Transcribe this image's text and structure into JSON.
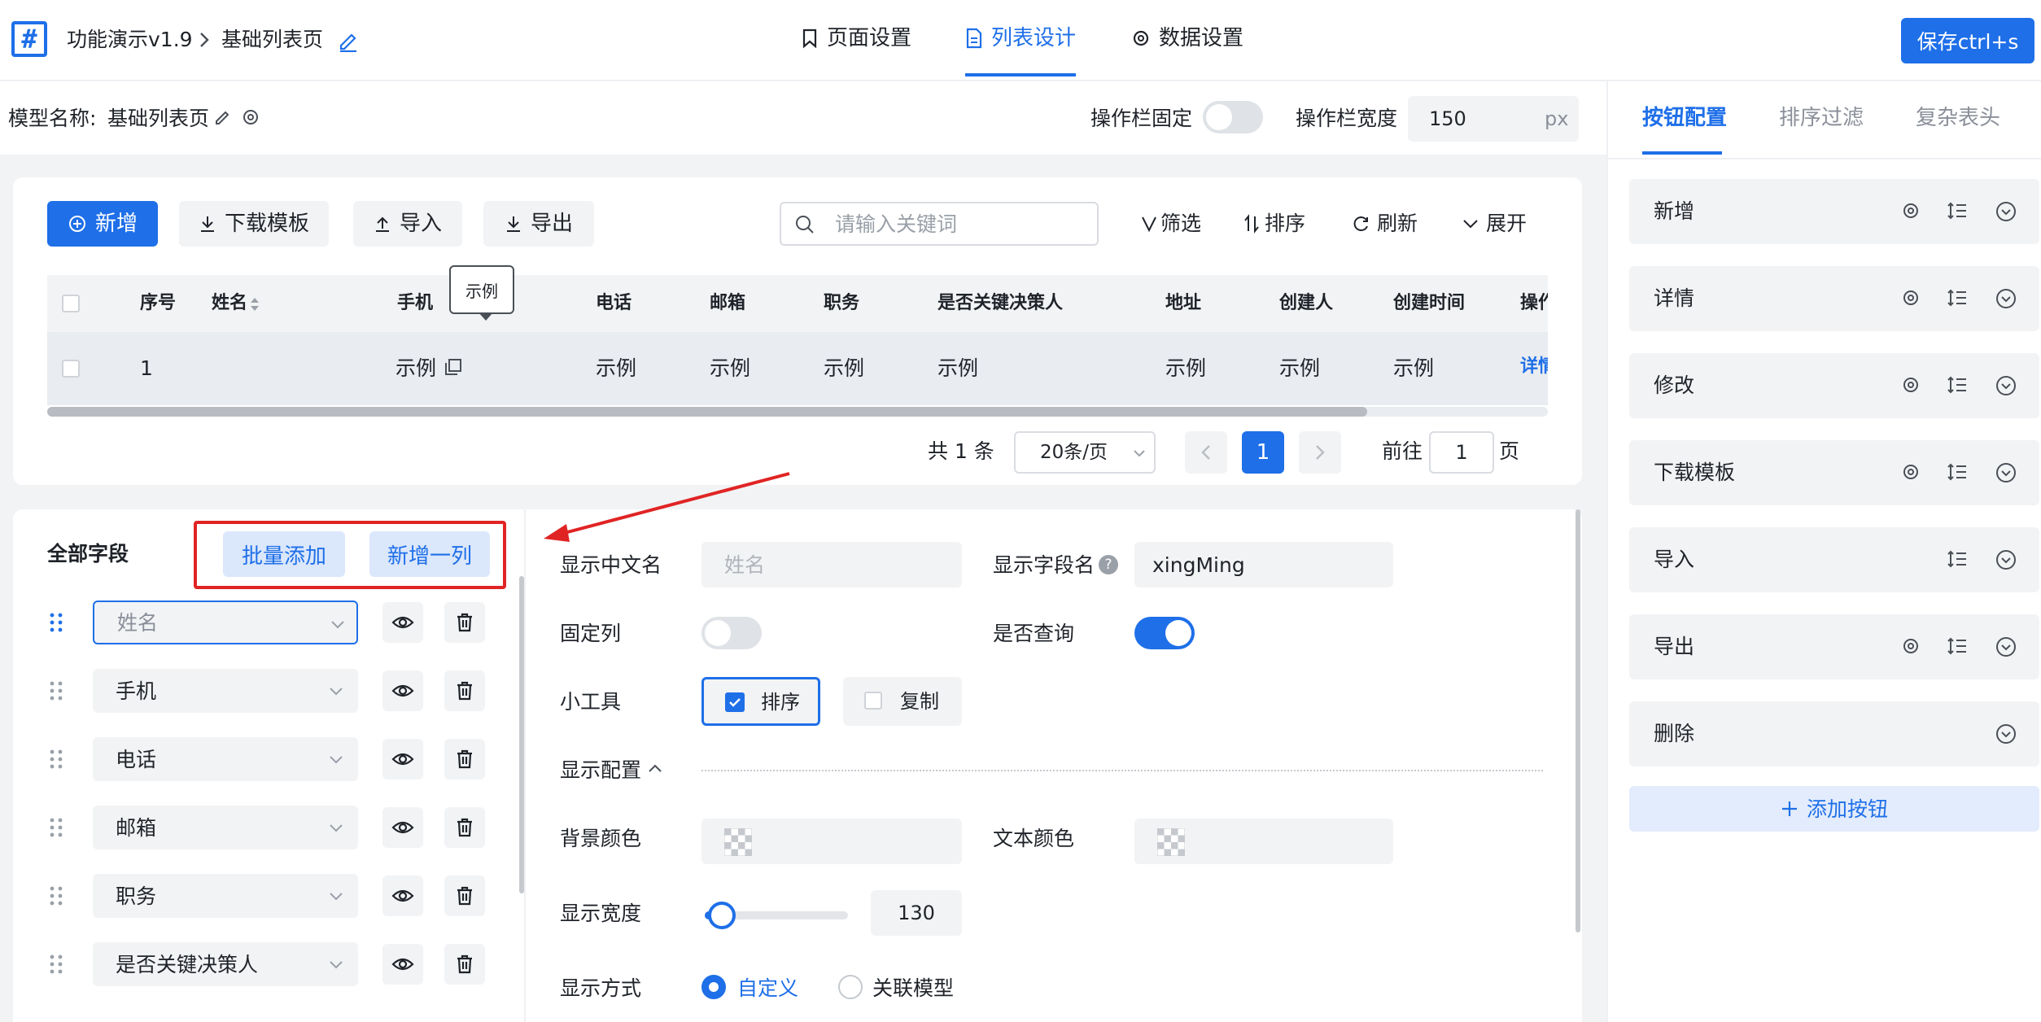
{
  "header": {
    "app_title": "功能演示v1.9",
    "page_name": "基础列表页",
    "tabs": [
      {
        "label": "页面设置",
        "icon": "bookmark-icon"
      },
      {
        "label": "列表设计",
        "icon": "document-icon"
      },
      {
        "label": "数据设置",
        "icon": "gear-icon"
      }
    ],
    "active_tab": "列表设计",
    "save_label": "保存ctrl+s"
  },
  "model_bar": {
    "model_label": "模型名称:",
    "model_name": "基础列表页",
    "fixed_label": "操作栏固定",
    "fixed_on": false,
    "width_label": "操作栏宽度",
    "width_value": "150",
    "width_unit": "px"
  },
  "toolbar": {
    "add_label": "新增",
    "download_label": "下载模板",
    "import_label": "导入",
    "export_label": "导出",
    "search_placeholder": "请输入关键词",
    "filter_label": "筛选",
    "sort_label": "排序",
    "refresh_label": "刷新",
    "expand_label": "展开"
  },
  "table": {
    "columns": [
      "序号",
      "姓名",
      "手机",
      "电话",
      "邮箱",
      "职务",
      "是否关键决策人",
      "地址",
      "创建人",
      "创建时间",
      "操作"
    ],
    "row": {
      "index": "1",
      "phone": "示例",
      "tel": "示例",
      "email": "示例",
      "job": "示例",
      "key_decision": "示例",
      "address": "示例",
      "creator": "示例",
      "created": "示例",
      "action": "详情"
    },
    "tooltip": "示例"
  },
  "pager": {
    "total": "共 1 条",
    "page_size": "20条/页",
    "current_page": "1",
    "goto_label": "前往",
    "goto_value": "1",
    "page_unit": "页"
  },
  "fields_panel": {
    "title": "全部字段",
    "batch_add": "批量添加",
    "add_column": "新增一列",
    "fields": [
      "姓名",
      "手机",
      "电话",
      "邮箱",
      "职务",
      "是否关键决策人"
    ]
  },
  "field_form": {
    "cn_name_label": "显示中文名",
    "cn_name_placeholder": "姓名",
    "field_name_label": "显示字段名",
    "field_name_value": "xingMing",
    "fixed_col_label": "固定列",
    "fixed_col_on": false,
    "query_label": "是否查询",
    "query_on": true,
    "tools_label": "小工具",
    "tool_sort": "排序",
    "tool_sort_checked": true,
    "tool_copy": "复制",
    "tool_copy_checked": false,
    "display_config_label": "显示配置",
    "bg_color_label": "背景颜色",
    "text_color_label": "文本颜色",
    "width_label": "显示宽度",
    "width_value": "130",
    "width_slider_fraction": 0.12,
    "display_mode_label": "显示方式",
    "mode_custom": "自定义",
    "mode_related": "关联模型",
    "selected_mode": "自定义"
  },
  "sidebar": {
    "tabs": [
      "按钮配置",
      "排序过滤",
      "复杂表头"
    ],
    "active_tab": "按钮配置",
    "items": [
      {
        "label": "新增",
        "icons": [
          "gear-icon",
          "sort-list-icon",
          "chevron-down-icon"
        ]
      },
      {
        "label": "详情",
        "icons": [
          "gear-icon",
          "sort-list-icon",
          "chevron-down-icon"
        ]
      },
      {
        "label": "修改",
        "icons": [
          "gear-icon",
          "sort-list-icon",
          "chevron-down-icon"
        ]
      },
      {
        "label": "下载模板",
        "icons": [
          "gear-icon",
          "sort-list-icon",
          "chevron-down-icon"
        ]
      },
      {
        "label": "导入",
        "icons": [
          "sort-list-icon",
          "chevron-down-icon"
        ]
      },
      {
        "label": "导出",
        "icons": [
          "gear-icon",
          "sort-list-icon",
          "chevron-down-icon"
        ]
      },
      {
        "label": "删除",
        "icons": [
          "chevron-down-icon"
        ]
      }
    ],
    "add_button": "添加按钮"
  },
  "colors": {
    "primary": "#1e6fe8",
    "annotation_red": "#e02424",
    "panel_bg": "#f2f3f5"
  }
}
